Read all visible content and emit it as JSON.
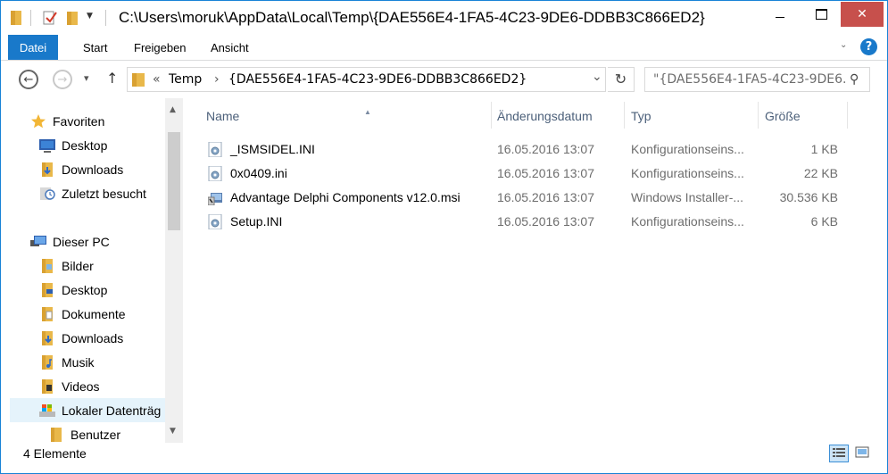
{
  "window": {
    "title": "C:\\Users\\moruk\\AppData\\Local\\Temp\\{DAE556E4-1FA5-4C23-9DE6-DDBB3C866ED2}",
    "close_glyph": "✕"
  },
  "ribbon": {
    "tabs": [
      {
        "label": "Datei",
        "active": true
      },
      {
        "label": "Start"
      },
      {
        "label": "Freigeben"
      },
      {
        "label": "Ansicht"
      }
    ],
    "help_label": "?"
  },
  "navbar": {
    "back_glyph": "←",
    "forward_glyph": "→",
    "recent_glyph": "▾",
    "up_glyph": "↑",
    "breadcrumb_overflow": "«",
    "breadcrumb": [
      "Temp",
      "{DAE556E4-1FA5-4C23-9DE6-DDBB3C866ED2}"
    ],
    "breadcrumb_sep": "›",
    "dropdown_glyph": "⌄",
    "refresh_glyph": "↻",
    "search_placeholder": "\"{DAE556E4-1FA5-4C23-9DE6...",
    "search_glyph": "⚲"
  },
  "sidebar": {
    "items": [
      {
        "label": "Favoriten",
        "icon": "star-icon"
      },
      {
        "label": "Desktop",
        "icon": "desktop-icon"
      },
      {
        "label": "Downloads",
        "icon": "folder-icon"
      },
      {
        "label": "Zuletzt besucht",
        "icon": "recent-places-icon"
      },
      {
        "label": "Dieser PC",
        "icon": "computer-icon"
      },
      {
        "label": "Bilder",
        "icon": "folder-icon"
      },
      {
        "label": "Desktop",
        "icon": "folder-icon"
      },
      {
        "label": "Dokumente",
        "icon": "folder-icon"
      },
      {
        "label": "Downloads",
        "icon": "folder-icon"
      },
      {
        "label": "Musik",
        "icon": "folder-icon"
      },
      {
        "label": "Videos",
        "icon": "folder-icon"
      },
      {
        "label": "Lokaler Datenträg",
        "icon": "drive-icon"
      },
      {
        "label": "Benutzer",
        "icon": "folder-icon"
      }
    ],
    "scroll_up": "▲",
    "scroll_down": "▼"
  },
  "columns": {
    "name": "Name",
    "date": "Änderungsdatum",
    "type": "Typ",
    "size": "Größe",
    "sort_glyph": "▲"
  },
  "files": [
    {
      "name": "_ISMSIDEL.INI",
      "date": "16.05.2016 13:07",
      "type": "Konfigurationseins...",
      "size": "1 KB",
      "icon": "ini-file-icon"
    },
    {
      "name": "0x0409.ini",
      "date": "16.05.2016 13:07",
      "type": "Konfigurationseins...",
      "size": "22 KB",
      "icon": "ini-file-icon"
    },
    {
      "name": "Advantage Delphi Components v12.0.msi",
      "date": "16.05.2016 13:07",
      "type": "Windows Installer-...",
      "size": "30.536 KB",
      "icon": "msi-file-icon"
    },
    {
      "name": "Setup.INI",
      "date": "16.05.2016 13:07",
      "type": "Konfigurationseins...",
      "size": "6 KB",
      "icon": "ini-file-icon"
    }
  ],
  "status": {
    "count_text": "4 Elemente"
  },
  "colors": {
    "accent": "#1979ca",
    "close": "#c7504c",
    "header_text": "#4c607a",
    "secondary_text": "#6d6d6d",
    "folder": "#e9b84a"
  }
}
